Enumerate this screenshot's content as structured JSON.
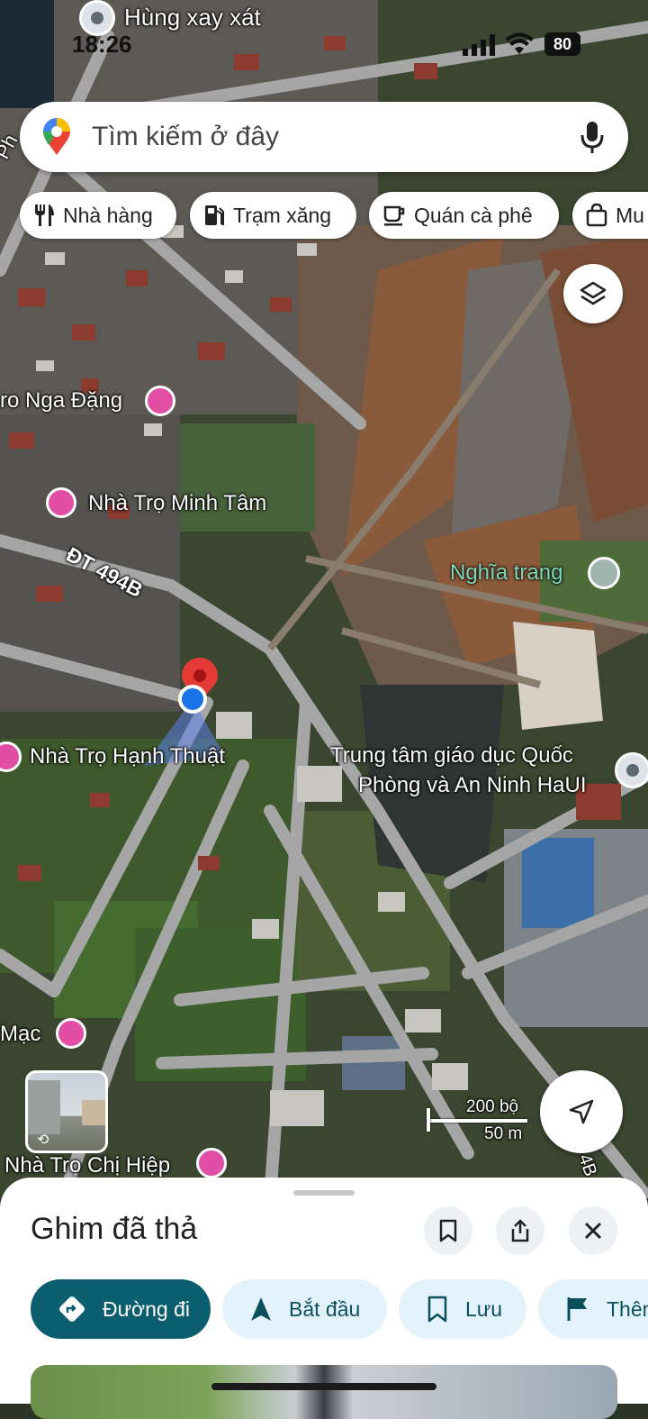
{
  "status_bar": {
    "time": "18:26",
    "battery": "80"
  },
  "top_place": "Hùng xay xát",
  "search": {
    "placeholder": "Tìm kiếm ở đây"
  },
  "chips": [
    {
      "label": "Nhà hàng",
      "icon": "fork-knife-icon"
    },
    {
      "label": "Trạm xăng",
      "icon": "gas-station-icon"
    },
    {
      "label": "Quán cà phê",
      "icon": "coffee-icon"
    },
    {
      "label": "Mu",
      "icon": "shopping-bag-icon"
    }
  ],
  "map_labels": {
    "street_top_left": "Ph",
    "nga_dang": "ro Nga Đặng",
    "minh_tam": "Nhà Trọ Minh Tâm",
    "road": "ĐT 494B",
    "nghia_trang": "Nghĩa trang",
    "hanh_thuat": "Nhà Trọ Hạnh Thuật",
    "training_center_line1": "Trung tâm giáo dục Quốc",
    "training_center_line2": "Phòng và An Ninh HaUI",
    "mac": "Mạc",
    "chi_hiep": "Nhà Trọ Chị Hiệp",
    "road_edge": "4B"
  },
  "scale": {
    "imperial": "200 bộ",
    "metric": "50 m"
  },
  "sheet": {
    "title": "Ghim đã thả",
    "actions": [
      {
        "label": "Đường đi",
        "icon": "directions-icon",
        "primary": true
      },
      {
        "label": "Bắt đầu",
        "icon": "navigation-arrow-icon"
      },
      {
        "label": "Lưu",
        "icon": "bookmark-icon"
      },
      {
        "label": "Thêm",
        "icon": "flag-icon"
      }
    ]
  },
  "colors": {
    "primary": "#0b5e6e",
    "chip_bg": "#e4f3fb",
    "pin_red": "#e53935",
    "location_blue": "#1a73e8",
    "lodging_pink": "#e24da6"
  }
}
